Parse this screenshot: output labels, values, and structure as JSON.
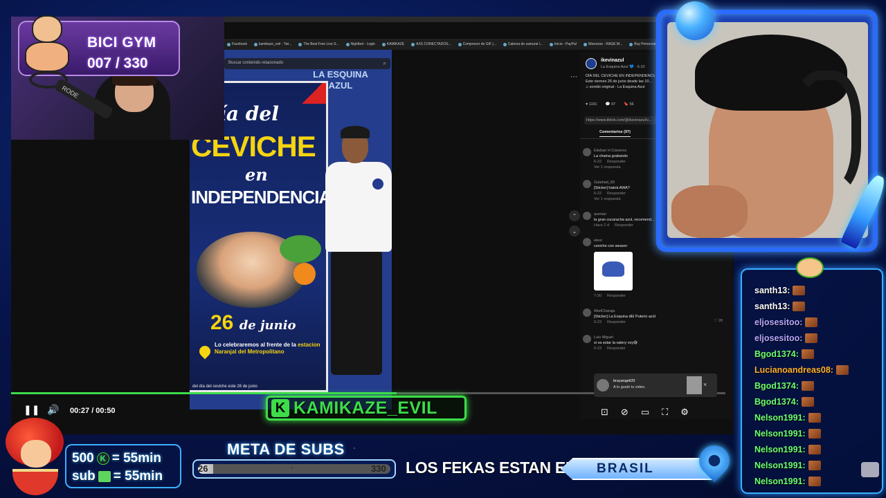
{
  "browser": {
    "bookmarks": [
      "Facebook",
      "kamikaze_evil - Twi...",
      "The Best Free Live S...",
      "Nightbot - Login",
      "KAMIKAZE",
      "AXS CONECTADOS...",
      "Compresor de GIF |...",
      "Cabeza de samurai l...",
      "Inicio - PayPal",
      "Weezone - RAGE M...",
      "Buy Personalized 11..."
    ]
  },
  "video": {
    "search_placeholder": "Buscar contenido relacionado",
    "wall_sign": "LA ESQUINA AZUL",
    "poster": {
      "line1": "Día del",
      "line2": "CEVICHE",
      "line3": "en",
      "line4": "INDEPENDENCIA",
      "date": "26",
      "date_suffix": "de junio",
      "info": "Lo celebraremos al frente de la",
      "info_highlight": "estacion Naranjal del Metropolitano"
    },
    "caption": "del día del ceviche este 26 de junio"
  },
  "sidebar": {
    "username": "ikevinazul",
    "handle": "La Esquina Azul 💙 · 6-22",
    "desc_lines": [
      "DÍA DEL CEVICHE EN INDEPENDENCIA",
      "Este viernes 26 de junio desde las 10...",
      "♫ sonido original - La Esquina Azul"
    ],
    "stats": [
      "♥ 1191",
      "💬 97",
      "🔖 56"
    ],
    "link": "https://www.tiktok.com/@ikevinazul/v...",
    "tab": "Comentarios (97)",
    "comments": [
      {
        "name": "Elieban H Cisneros",
        "text": "La chama grabando",
        "date": "6-22",
        "reply": "Responder",
        "extra": "Ver 1 respuesta"
      },
      {
        "name": "Galahad_83",
        "text": "[Sticker] habrá AWA?",
        "date": "6-22",
        "reply": "Responder",
        "extra": "Ver 1 respuesta"
      },
      {
        "name": "averian",
        "text": "la gran cucaracha azul, recomend...",
        "date": "Hace 2 d",
        "reply": "Responder",
        "extra": ""
      },
      {
        "name": "eleor",
        "text": "ceviche con weaver",
        "date": "7-30",
        "reply": "Responder",
        "extra": "",
        "like": "♡ 28"
      },
      {
        "name": "AbelCharaja",
        "text": "[Sticker] La Esquina dEl Puterio azúl",
        "date": "6-23",
        "reply": "Responder",
        "extra": "",
        "like": "♡ 28"
      },
      {
        "name": "Luis Miguel",
        "text": "si va estar la valery voy😅",
        "date": "6-23",
        "reply": "Responder",
        "extra": ""
      }
    ],
    "more": "⋯",
    "nav_up": "⌃",
    "nav_down": "⌄"
  },
  "notification": {
    "name": "brayangeli20",
    "message": "A lo gustó tu video.",
    "close": "×"
  },
  "player": {
    "time": "00:27 / 00:50",
    "play_pause": "❚❚",
    "volume": "🔊",
    "progress": 0.54,
    "right_controls": [
      "⊡",
      "⊘",
      "▭",
      "⛶",
      "⚙"
    ]
  },
  "overlay": {
    "gym_title": "BICI GYM",
    "gym_count": "007 / 330",
    "mic_label": "RODE",
    "kick_name": "KAMIKAZE_EVIL",
    "kick_letter": "K",
    "subs_line1_amount": "500",
    "subs_line1_value": "= 55min",
    "subs_line2_label": "sub",
    "subs_line2_value": "= 55min",
    "meta_title": "META DE SUBS",
    "meta_current": "26",
    "meta_mid": "-",
    "meta_goal": "330",
    "meta_fraction": 0.079,
    "fekas_text": "LOS FEKAS ESTAN EN:",
    "country": "BRASIL"
  },
  "chat": {
    "messages": [
      {
        "user": "santh13:",
        "color": "#ffffff"
      },
      {
        "user": "santh13:",
        "color": "#ffffff"
      },
      {
        "user": "eljosesitoo:",
        "color": "#b8a6ff"
      },
      {
        "user": "eljosesitoo:",
        "color": "#b8a6ff"
      },
      {
        "user": "Bgod1374:",
        "color": "#6dff6d"
      },
      {
        "user": "Lucianoandreas08:",
        "color": "#ffb02e"
      },
      {
        "user": "Bgod1374:",
        "color": "#6dff6d"
      },
      {
        "user": "Bgod1374:",
        "color": "#6dff6d"
      },
      {
        "user": "Nelson1991:",
        "color": "#6dff6d"
      },
      {
        "user": "Nelson1991:",
        "color": "#6dff6d"
      },
      {
        "user": "Nelson1991:",
        "color": "#6dff6d"
      },
      {
        "user": "Nelson1991:",
        "color": "#6dff6d"
      },
      {
        "user": "Nelson1991:",
        "color": "#6dff6d"
      }
    ]
  },
  "colors": {
    "kick_green": "#3ddc4a",
    "frame_blue": "#2a6bff"
  }
}
